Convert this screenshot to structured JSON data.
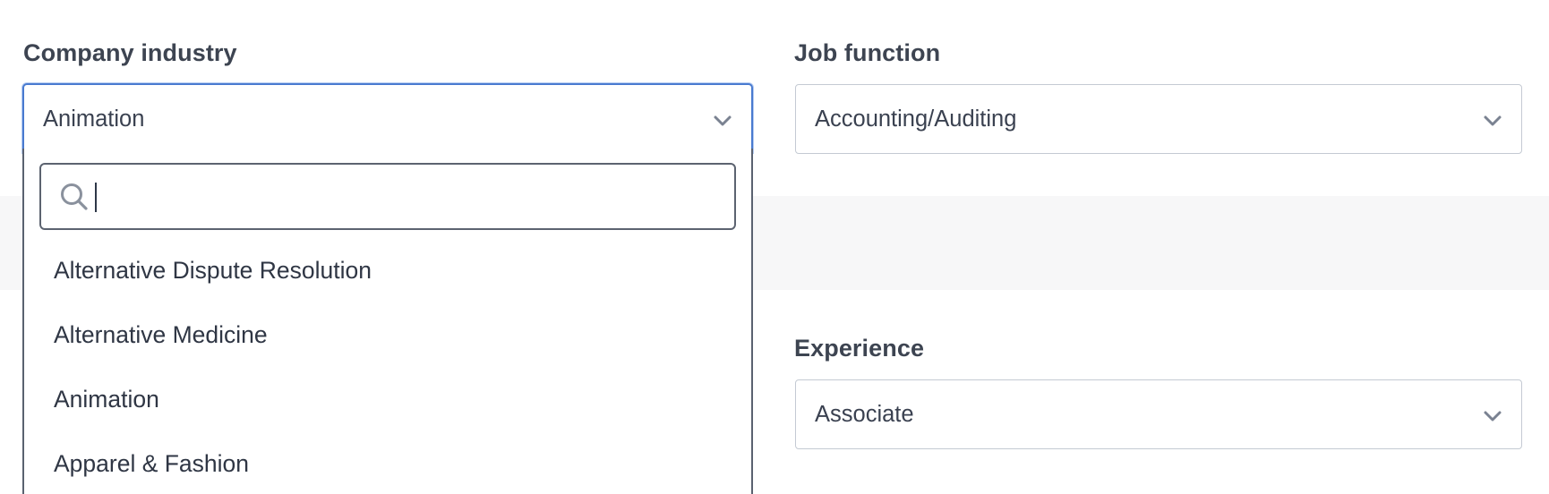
{
  "company_industry": {
    "label": "Company industry",
    "selected": "Animation",
    "search_value": "",
    "options": [
      "Alternative Dispute Resolution",
      "Alternative Medicine",
      "Animation",
      "Apparel & Fashion"
    ]
  },
  "job_function": {
    "label": "Job function",
    "selected": "Accounting/Auditing"
  },
  "experience": {
    "label": "Experience",
    "selected": "Associate"
  },
  "icons": {
    "chevron": "chevron-down-icon",
    "search": "search-icon"
  },
  "colors": {
    "focus_border": "#4a7bd0",
    "band_background": "#f7f7f8"
  }
}
